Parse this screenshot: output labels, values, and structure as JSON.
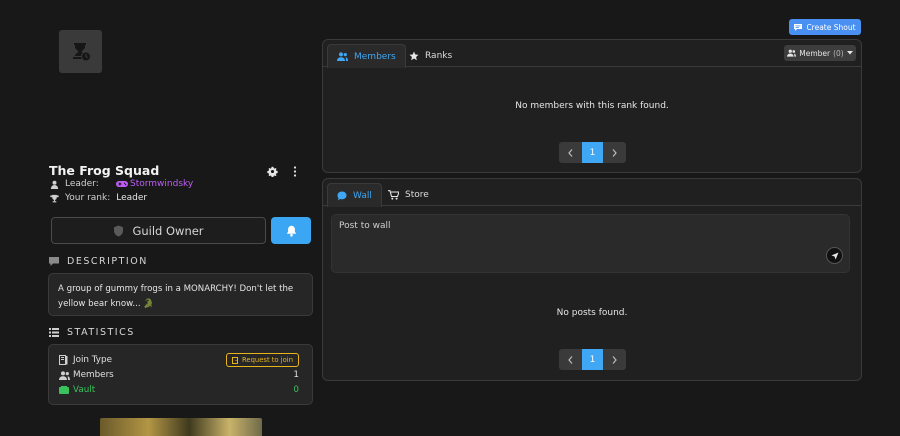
{
  "guild": {
    "name": "The Frog Squad",
    "leader_label": "Leader:",
    "leader_name": "Stormwindsky",
    "rank_label": "Your rank:",
    "rank_value": "Leader",
    "owner_button_label": "Guild Owner"
  },
  "description": {
    "title": "DESCRIPTION",
    "text": "A group of gummy frogs in a MONARCHY! Don't let the yellow bear know... 🐊"
  },
  "statistics": {
    "title": "STATISTICS",
    "join_type_label": "Join Type",
    "join_type_value": "Request to join",
    "members_label": "Members",
    "members_value": "1",
    "vault_label": "Vault",
    "vault_value": "0"
  },
  "header": {
    "create_shout_label": "Create Shout"
  },
  "members_panel": {
    "tabs": [
      {
        "label": "Members"
      },
      {
        "label": "Ranks"
      }
    ],
    "rank_select_label": "Member",
    "rank_select_count": "(0)",
    "empty_message": "No members with this rank found.",
    "page": "1"
  },
  "wall_panel": {
    "tabs": [
      {
        "label": "Wall"
      },
      {
        "label": "Store"
      }
    ],
    "input_placeholder": "Post to wall",
    "empty_message": "No posts found.",
    "page": "1"
  },
  "colors": {
    "accent": "#3fa7f3",
    "leader": "#c05cf5",
    "vault_green": "#39c25c",
    "badge_yellow": "#e8b41c"
  },
  "icons": [
    "hourglass-clock-icon",
    "gear-icon",
    "kebab-icon",
    "user-icon",
    "trophy-icon",
    "shield-icon",
    "bell-icon",
    "comment-icon",
    "list-icon",
    "join-icon",
    "members-icon",
    "vault-icon",
    "shout-icon",
    "star-icon",
    "cart-icon",
    "send-icon",
    "chevron-left-icon",
    "chevron-right-icon",
    "caret-down-icon"
  ]
}
